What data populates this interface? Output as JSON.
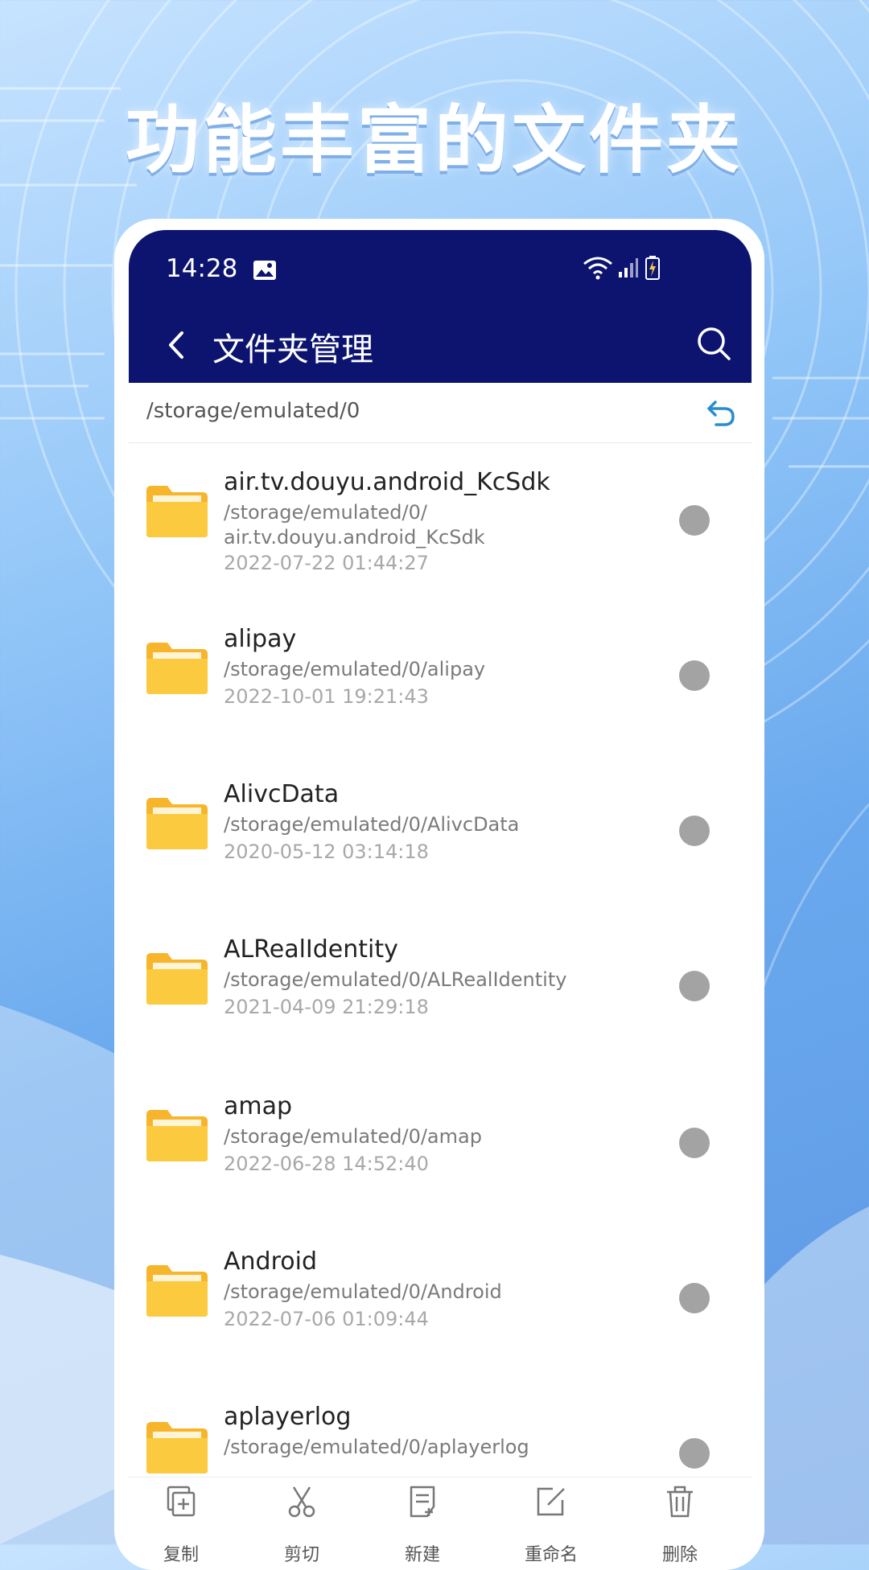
{
  "headline": "功能丰富的文件夹",
  "status_bar": {
    "time": "14:28"
  },
  "toolbar": {
    "title": "文件夹管理"
  },
  "current_path": "/storage/emulated/0",
  "folders": [
    {
      "name": "air.tv.douyu.android_KcSdk",
      "path_line1": "/storage/emulated/0/",
      "path_line2": "air.tv.douyu.android_KcSdk",
      "date": "2022-07-22 01:44:27"
    },
    {
      "name": "alipay",
      "path_line1": "/storage/emulated/0/alipay",
      "date": "2022-10-01 19:21:43"
    },
    {
      "name": "AlivcData",
      "path_line1": "/storage/emulated/0/AlivcData",
      "date": "2020-05-12 03:14:18"
    },
    {
      "name": "ALRealIdentity",
      "path_line1": "/storage/emulated/0/ALRealIdentity",
      "date": "2021-04-09 21:29:18"
    },
    {
      "name": "amap",
      "path_line1": "/storage/emulated/0/amap",
      "date": "2022-06-28 14:52:40"
    },
    {
      "name": "Android",
      "path_line1": "/storage/emulated/0/Android",
      "date": "2022-07-06 01:09:44"
    },
    {
      "name": "aplayerlog",
      "path_line1": "/storage/emulated/0/aplayerlog",
      "date": ""
    }
  ],
  "actions": [
    {
      "label": "复制",
      "icon": "copy-icon"
    },
    {
      "label": "剪切",
      "icon": "cut-icon"
    },
    {
      "label": "新建",
      "icon": "new-file-icon"
    },
    {
      "label": "重命名",
      "icon": "rename-icon"
    },
    {
      "label": "删除",
      "icon": "delete-icon"
    }
  ],
  "colors": {
    "appbar": "#0c1470",
    "folder": "#fbc531",
    "accent": "#2a8ccf",
    "radio": "#a3a3a3"
  }
}
